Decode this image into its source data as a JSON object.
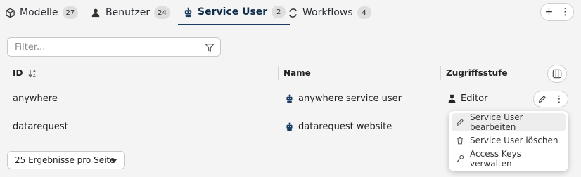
{
  "tabs": [
    {
      "label": "Modelle",
      "count": "27",
      "icon": "cube-icon"
    },
    {
      "label": "Benutzer",
      "count": "24",
      "icon": "user-icon"
    },
    {
      "label": "Service User",
      "count": "2",
      "icon": "robot-icon"
    },
    {
      "label": "Workflows",
      "count": "4",
      "icon": "workflow-icon"
    }
  ],
  "top_actions": {
    "add": "+",
    "more": "⋮"
  },
  "filter": {
    "placeholder": "Filter...",
    "value": ""
  },
  "table": {
    "headers": {
      "id": "ID",
      "name": "Name",
      "access": "Zugriffsstufe"
    },
    "rows": [
      {
        "id": "anywhere",
        "name": "anywhere service user",
        "access": "Editor"
      },
      {
        "id": "datarequest",
        "name": "datarequest website",
        "access": ""
      }
    ]
  },
  "row_actions": {
    "more": "⋮"
  },
  "context_menu": {
    "items": [
      {
        "label": "Service User bearbeiten",
        "icon": "pencil-icon"
      },
      {
        "label": "Service User löschen",
        "icon": "trash-icon"
      },
      {
        "label": "Access Keys verwalten",
        "icon": "key-icon"
      }
    ]
  },
  "pagination": {
    "per_page_label": "25 Ergebnisse pro Seite"
  },
  "colors": {
    "active_tab": "#183c62",
    "accent_icon": "#183c62"
  }
}
